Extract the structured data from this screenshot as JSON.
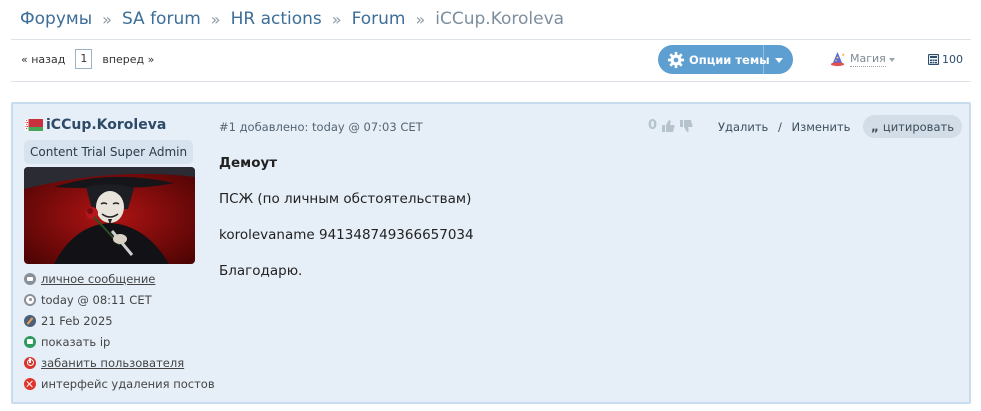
{
  "breadcrumb": {
    "items": [
      "Форумы",
      "SA forum",
      "HR actions",
      "Forum"
    ],
    "current": "iCCup.Koroleva",
    "separator": "»"
  },
  "pager": {
    "prev": "« назад",
    "page": "1",
    "next": "вперед »"
  },
  "toolbar": {
    "options_label": "Опции темы",
    "magic_label": "Магия",
    "count": "100"
  },
  "post": {
    "username": "iCCup.Koroleva",
    "role": "Content Trial Super Admin",
    "meta": "#1 добавлено: today @ 07:03 CET",
    "votes": "0",
    "delete_label": "Удалить",
    "action_sep": "/",
    "edit_label": "Изменить",
    "quote_label": "цитировать",
    "quote_icon": "„",
    "title": "Демоут",
    "lines": [
      "ПСЖ (по личным обстоятельствам)",
      "korolevaname 941348749366657034",
      "Благодарю."
    ]
  },
  "user_links": [
    {
      "label": "личное сообщение",
      "icon": "message-icon"
    },
    {
      "label": "today @ 08:11 CET",
      "icon": "clock-icon"
    },
    {
      "label": "21 Feb 2025",
      "icon": "compass-icon"
    },
    {
      "label": "показать ip",
      "icon": "ip-icon"
    },
    {
      "label": "забанить пользователя",
      "icon": "ban-icon"
    },
    {
      "label": "интерфейс удаления постов",
      "icon": "delete-posts-icon"
    }
  ],
  "colors": {
    "link": "#3d6e99",
    "button": "#5d9fd0",
    "post_bg": "#e6eff8",
    "post_border": "#c8dcef"
  }
}
